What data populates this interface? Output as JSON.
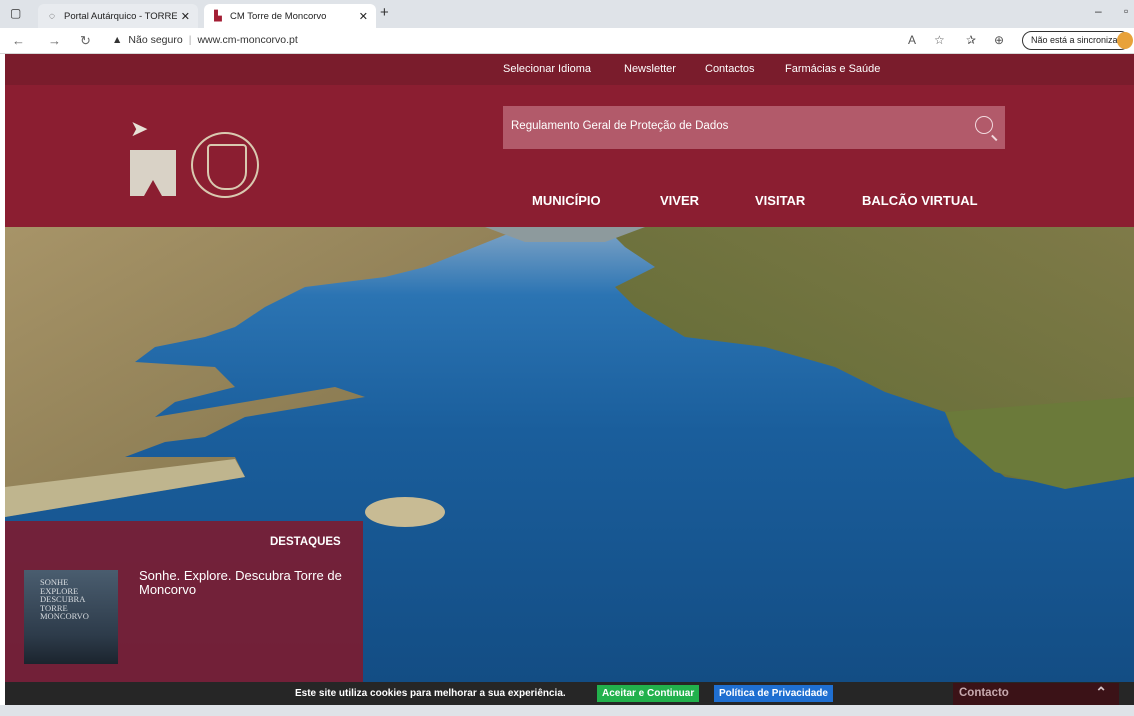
{
  "browser": {
    "tabs": [
      {
        "title": "Portal Autárquico - TORRE DE M..."
      },
      {
        "title": "CM Torre de Moncorvo"
      }
    ],
    "url_warning": "Não seguro",
    "url": "www.cm-moncorvo.pt",
    "sync_label": "Não está a sincronizar"
  },
  "site": {
    "top_links": [
      "Selecionar Idioma",
      "Newsletter",
      "Contactos",
      "Farmácias e Saúde"
    ],
    "search": {
      "value": "Regulamento Geral de Proteção de Dados"
    },
    "main_nav": [
      "MUNICÍPIO",
      "VIVER",
      "VISITAR",
      "BALCÃO VIRTUAL"
    ],
    "destaques": {
      "title": "DESTAQUES",
      "headline": "Sonhe. Explore. Descubra Torre de Moncorvo",
      "thumb_text": "SONHE\nEXPLORE\nDESCUBRA\nTORRE\nMONCORVO"
    },
    "cookie": {
      "text": "Este site utiliza cookies para melhorar a sua experiência.",
      "accept": "Aceitar e Continuar",
      "policy": "Política de Privacidade"
    },
    "contact_widget": "Contacto"
  },
  "colors": {
    "brand": "#8b1e31",
    "brand_dark": "#7a1c2c",
    "accept": "#22b14c",
    "policy": "#1f6fd1"
  }
}
